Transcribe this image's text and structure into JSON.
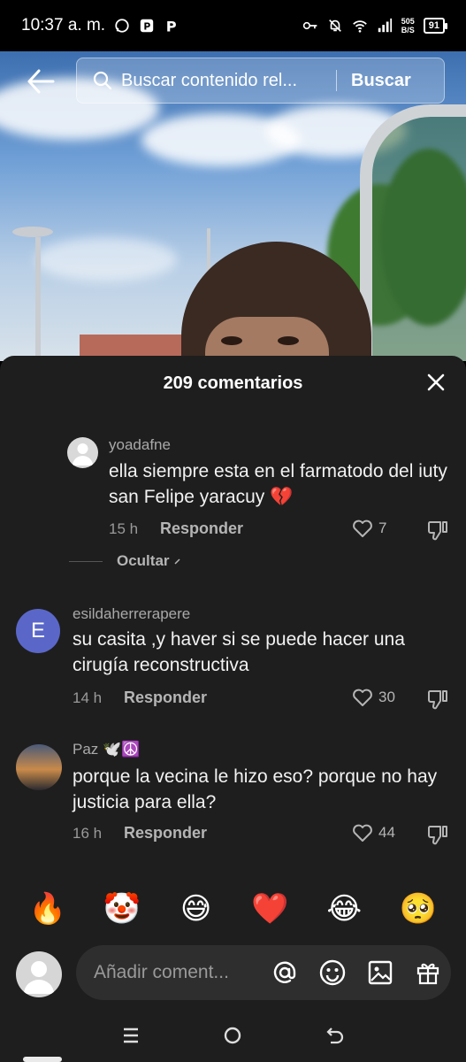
{
  "status_bar": {
    "time": "10:37 a. m.",
    "net_speed_value": "505",
    "net_speed_unit": "B/S",
    "battery": "91",
    "icons": [
      "whatsapp-icon",
      "parking-icon",
      "p-app-icon",
      "key-icon",
      "mute-icon",
      "wifi-icon",
      "signal-icon",
      "battery-icon"
    ]
  },
  "search": {
    "placeholder": "Buscar contenido rel...",
    "button_label": "Buscar"
  },
  "comments_sheet": {
    "title": "209 comentarios",
    "hide_label": "Ocultar",
    "comments": [
      {
        "user": "yoadafne",
        "text": "ella siempre esta en el farmatodo del iuty san Felipe yaracuy 💔",
        "time": "15 h",
        "reply_label": "Responder",
        "likes": "7",
        "avatar": "default-avatar"
      },
      {
        "user": "esildaherrerapere",
        "text": "su casita ,y haver si se puede hacer una cirugía reconstructiva",
        "time": "14 h",
        "reply_label": "Responder",
        "likes": "30",
        "avatar_letter": "E"
      },
      {
        "user": "Paz 🕊️☮️",
        "text": "porque la vecina le hizo eso? porque no hay justicia para ella?",
        "time": "16 h",
        "reply_label": "Responder",
        "likes": "44",
        "avatar": "sunset-avatar"
      }
    ]
  },
  "emoji_bar": [
    "🔥",
    "🤡",
    "😅",
    "❤️",
    "😂",
    "🥺"
  ],
  "comment_input": {
    "placeholder": "Añadir coment..."
  },
  "colors": {
    "sheet_bg": "#1e1e1e",
    "avatar_e": "#5a67c8",
    "heart_red": "#e0242e"
  }
}
